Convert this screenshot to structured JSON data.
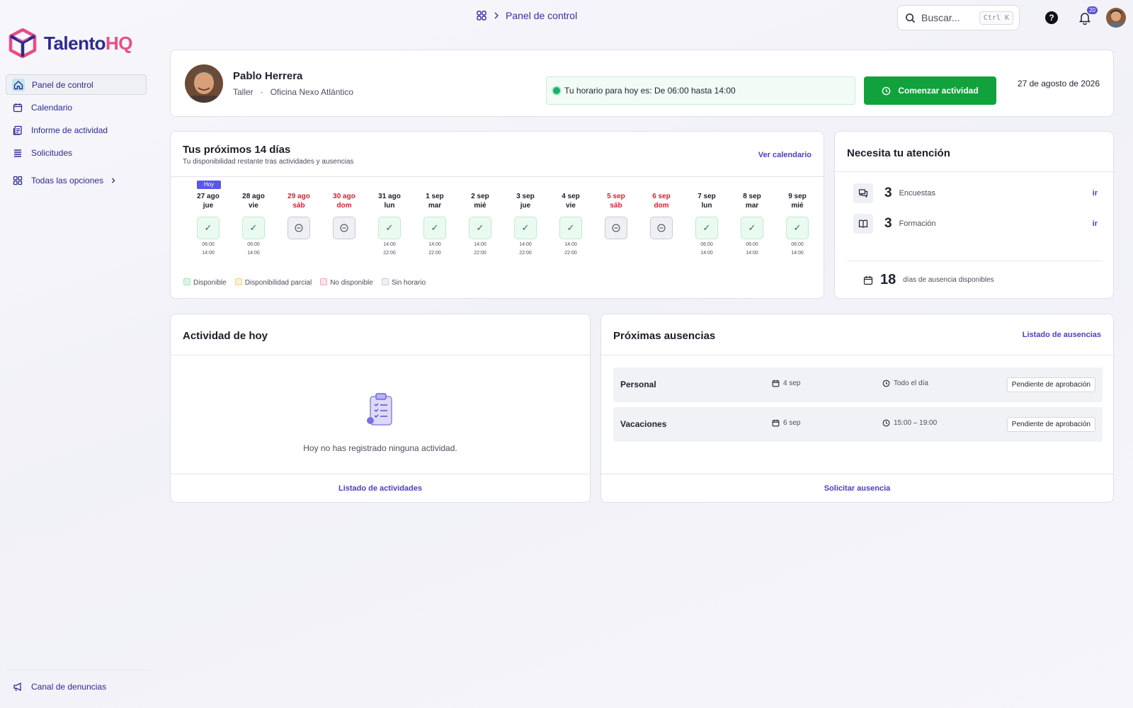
{
  "topbar": {
    "breadcrumb": "Panel de control",
    "search_placeholder": "Buscar...",
    "search_shortcut": "Ctrl K",
    "help_label": "?",
    "notifications_count": "20"
  },
  "brand": {
    "name_part1": "Talento",
    "name_part2": "HQ"
  },
  "sidebar": {
    "items": [
      {
        "label": "Panel de control",
        "icon": "home-icon",
        "active": true
      },
      {
        "label": "Calendario",
        "icon": "calendar-icon"
      },
      {
        "label": "Informe de actividad",
        "icon": "report-icon"
      },
      {
        "label": "Solicitudes",
        "icon": "list-icon"
      }
    ],
    "all_options": "Todas las opciones",
    "bottom_item": "Canal de denuncias"
  },
  "profile": {
    "name": "Pablo Herrera",
    "department": "Taller",
    "separator": "·",
    "office": "Oficina Nexo Atlántico",
    "schedule_text": "Tu horario para hoy es: De 06:00 hasta 14:00",
    "start_button": "Comenzar actividad",
    "date": "27 de agosto de 2026"
  },
  "next_days": {
    "title": "Tus próximos 14 días",
    "subtitle": "Tu disponibilidad restante tras actividades y ausencias",
    "link": "Ver calendario",
    "today_badge": "Hoy",
    "days": [
      {
        "date": "27 ago",
        "weekday": "jue",
        "status": "ok",
        "start": "06:00",
        "end": "14:00",
        "today": true
      },
      {
        "date": "28 ago",
        "weekday": "vie",
        "status": "ok",
        "start": "06:00",
        "end": "14:00"
      },
      {
        "date": "29 ago",
        "weekday": "sáb",
        "status": "off",
        "weekend": true
      },
      {
        "date": "30 ago",
        "weekday": "dom",
        "status": "off",
        "weekend": true
      },
      {
        "date": "31 ago",
        "weekday": "lun",
        "status": "ok",
        "start": "14:00",
        "end": "22:00"
      },
      {
        "date": "1 sep",
        "weekday": "mar",
        "status": "ok",
        "start": "14:00",
        "end": "22:00"
      },
      {
        "date": "2 sep",
        "weekday": "mié",
        "status": "ok",
        "start": "14:00",
        "end": "22:00"
      },
      {
        "date": "3 sep",
        "weekday": "jue",
        "status": "ok",
        "start": "14:00",
        "end": "22:00"
      },
      {
        "date": "4 sep",
        "weekday": "vie",
        "status": "ok",
        "start": "14:00",
        "end": "22:00"
      },
      {
        "date": "5 sep",
        "weekday": "sáb",
        "status": "off",
        "weekend": true
      },
      {
        "date": "6 sep",
        "weekday": "dom",
        "status": "off",
        "weekend": true
      },
      {
        "date": "7 sep",
        "weekday": "lun",
        "status": "ok",
        "start": "06:00",
        "end": "14:00"
      },
      {
        "date": "8 sep",
        "weekday": "mar",
        "status": "ok",
        "start": "06:00",
        "end": "14:00"
      },
      {
        "date": "9 sep",
        "weekday": "mié",
        "status": "ok",
        "start": "06:00",
        "end": "14:00"
      }
    ],
    "legend": [
      {
        "label": "Disponible",
        "color": "#d8f5e3",
        "border": "#a7e2bf"
      },
      {
        "label": "Disponibilidad parcial",
        "color": "#fdf0cf",
        "border": "#f1d38a"
      },
      {
        "label": "No disponible",
        "color": "#fde3ea",
        "border": "#f0a7bb"
      },
      {
        "label": "Sin horario",
        "color": "#eff0f3",
        "border": "#c9ccd4"
      }
    ]
  },
  "attention": {
    "title": "Necesita tu atención",
    "items": [
      {
        "count": "3",
        "label": "Encuestas",
        "action": "ir",
        "icon": "chat-icon"
      },
      {
        "count": "3",
        "label": "Formación",
        "action": "ir",
        "icon": "book-icon"
      }
    ],
    "absence_days": "18",
    "absence_label": "días de ausencia disponibles"
  },
  "today_activity": {
    "title": "Actividad de hoy",
    "empty_text": "Hoy no has registrado ninguna actividad.",
    "footer_link": "Listado de actividades"
  },
  "absences": {
    "title": "Próximas ausencias",
    "link": "Listado de ausencias",
    "rows": [
      {
        "type": "Personal",
        "date": "4 sep",
        "time": "Todo el día",
        "status": "Pendiente de aprobación"
      },
      {
        "type": "Vacaciones",
        "date": "6 sep",
        "time": "15:00 – 19:00",
        "status": "Pendiente de aprobación"
      }
    ],
    "footer_link": "Solicitar ausencia"
  },
  "colors": {
    "accent": "#4b3fc9",
    "brand_dark": "#2d2a8f",
    "brand_pink": "#e84d86",
    "start_button": "#11a23d",
    "weekend_text": "#d6202f"
  }
}
